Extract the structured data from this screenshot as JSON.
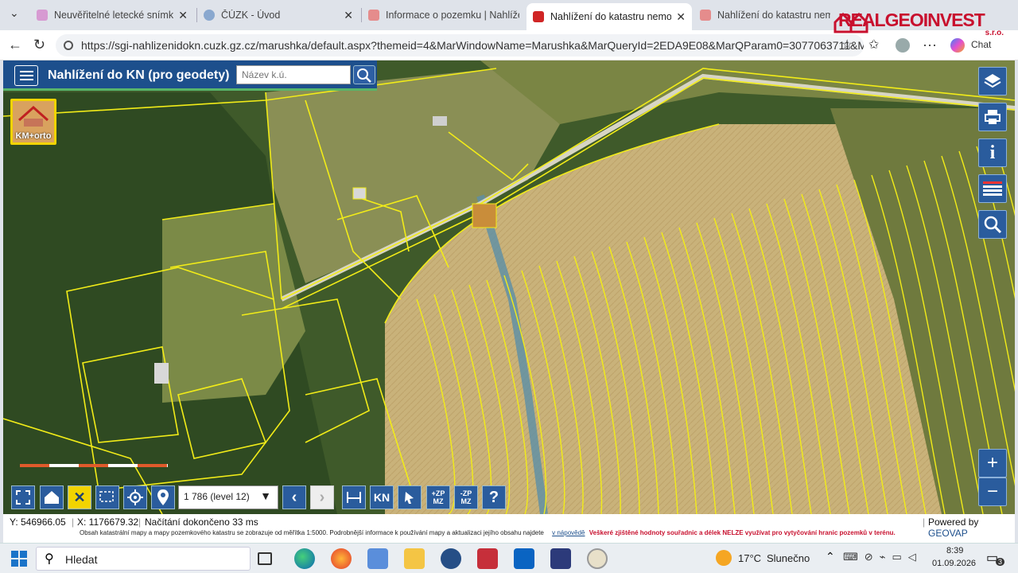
{
  "browser": {
    "tabs": [
      {
        "title": "Neuvěřitelné letecké snímky své",
        "color": "#d79ad2"
      },
      {
        "title": "ČÚZK - Úvod",
        "color": "#89a8cf"
      },
      {
        "title": "Informace o pozemku | Nahlíže",
        "color": "#e58c8c"
      },
      {
        "title": "Nahlížení do katastru nemovito",
        "color": "#d02525"
      },
      {
        "title": "Nahlížení do katastru nemovito",
        "color": "#e58c8c"
      }
    ],
    "url": "https://sgi-nahlizenidokn.cuzk.gz.cz/marushka/default.aspx?themeid=4&MarWindowName=Marushka&MarQueryId=2EDA9E08&MarQParam0=3077063711&M...",
    "chat_label": "Chat"
  },
  "watermark": {
    "text": "REALGEOINVEST",
    "sub": "s.r.o."
  },
  "app": {
    "title": "Nahlížení do KN (pro geodety)",
    "search_placeholder": "Název k.ú.",
    "layer_badge": "KM+orto",
    "scale_select": "1 786 (level 12)",
    "tool_kn": "KN",
    "tool_zoom_in": "+ZP MZ",
    "tool_zoom_out": "-ZP MZ",
    "help": "?"
  },
  "status": {
    "y_coord": "Y: 546966.05",
    "x_coord": "X: 1176679.32",
    "load": "Načítání dokončeno 33 ms",
    "powered": "Powered by",
    "powered_brand": "GEOVAP",
    "note": "Obsah katastrální mapy a mapy pozemkového katastru se zobrazuje od měřítka 1:5000. Podrobnější informace k používání mapy a aktualizaci jejího obsahu najdete",
    "note_link": "v nápovědě",
    "warning": "Veškeré zjištěné hodnoty souřadnic a délek NELZE využívat pro vytyčování hranic pozemků v terénu."
  },
  "taskbar": {
    "search": "Hledat",
    "weather_temp": "17°C",
    "weather_text": "Slunečno",
    "time": "8:39",
    "date": "01.09.2026",
    "notif": "3"
  }
}
